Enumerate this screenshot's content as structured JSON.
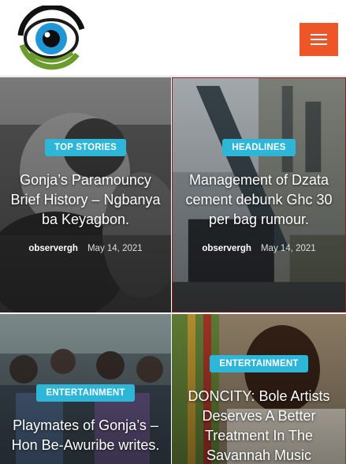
{
  "site": {
    "logo_icon": "eye-logo-icon",
    "menu_icon": "hamburger-menu-icon",
    "accent_color": "#ee5527",
    "badge_color": "#2db6d8"
  },
  "posts": [
    {
      "category": "TOP STORIES",
      "title": "Gonja’s Paramouncy Brief History – Ngbanya ba Keyagbon.",
      "author": "observergh",
      "date": "May 14, 2021"
    },
    {
      "category": "HEADLINES",
      "title": "Management of Dzata cement debunk Ghc 30 per bag rumour.",
      "author": "observergh",
      "date": "May 14, 2021"
    },
    {
      "category": "ENTERTAINMENT",
      "title": "Playmates of Gonja’s – Hon Be-Awuribe writes."
    },
    {
      "category": "ENTERTAINMENT",
      "title": "DONCITY: Bole Artists Deserves A Better Treatment In The Savannah Music"
    }
  ]
}
